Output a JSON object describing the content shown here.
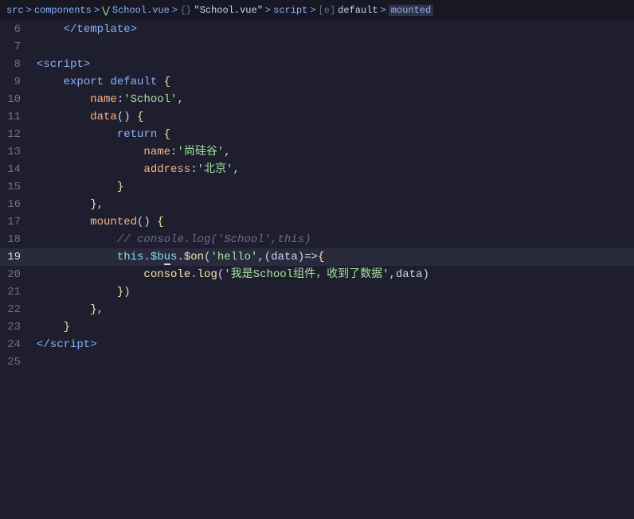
{
  "breadcrumb": {
    "items": [
      {
        "label": "src",
        "type": "dir"
      },
      {
        "label": ">",
        "type": "sep"
      },
      {
        "label": "components",
        "type": "dir"
      },
      {
        "label": ">",
        "type": "sep"
      },
      {
        "label": "School.vue",
        "type": "vue-icon"
      },
      {
        "label": ">",
        "type": "sep"
      },
      {
        "label": "{} \"School.vue\"",
        "type": "obj"
      },
      {
        "label": ">",
        "type": "sep"
      },
      {
        "label": "script",
        "type": "script"
      },
      {
        "label": ">",
        "type": "sep"
      },
      {
        "label": "[e] default",
        "type": "default"
      },
      {
        "label": ">",
        "type": "sep"
      },
      {
        "label": "mounted",
        "type": "mounted"
      }
    ]
  },
  "lines": [
    {
      "num": 6,
      "active": false
    },
    {
      "num": 7,
      "active": false
    },
    {
      "num": 8,
      "active": false
    },
    {
      "num": 9,
      "active": false
    },
    {
      "num": 10,
      "active": false
    },
    {
      "num": 11,
      "active": false
    },
    {
      "num": 12,
      "active": false
    },
    {
      "num": 13,
      "active": false
    },
    {
      "num": 14,
      "active": false
    },
    {
      "num": 15,
      "active": false
    },
    {
      "num": 16,
      "active": false
    },
    {
      "num": 17,
      "active": false
    },
    {
      "num": 18,
      "active": false
    },
    {
      "num": 19,
      "active": true
    },
    {
      "num": 20,
      "active": false
    },
    {
      "num": 21,
      "active": false
    },
    {
      "num": 22,
      "active": false
    },
    {
      "num": 23,
      "active": false
    },
    {
      "num": 24,
      "active": false
    },
    {
      "num": 25,
      "active": false
    }
  ]
}
